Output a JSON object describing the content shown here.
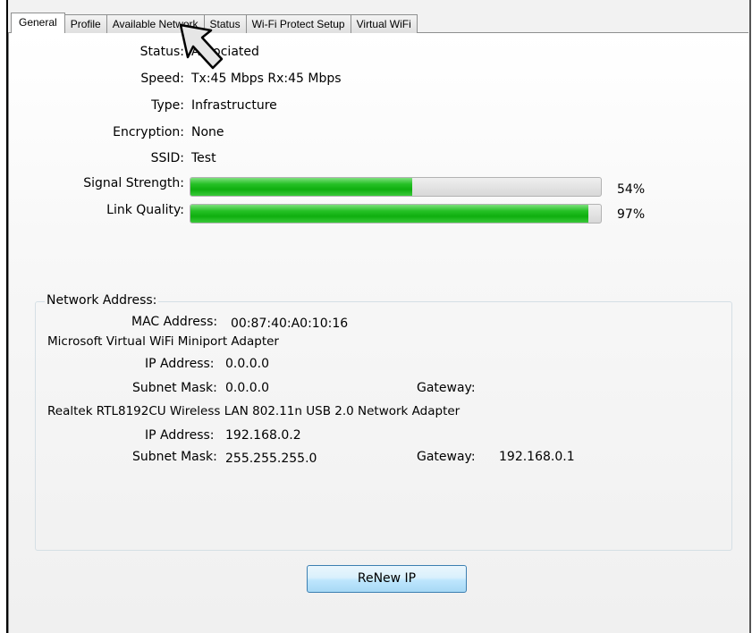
{
  "tabs": [
    {
      "label": "General",
      "active": true
    },
    {
      "label": "Profile",
      "active": false
    },
    {
      "label": "Available Network",
      "active": false
    },
    {
      "label": "Status",
      "active": false
    },
    {
      "label": "Wi-Fi Protect Setup",
      "active": false
    },
    {
      "label": "Virtual WiFi",
      "active": false
    }
  ],
  "general": {
    "status_label": "Status:",
    "status_value": "Associated",
    "speed_label": "Speed:",
    "speed_value": "Tx:45 Mbps Rx:45 Mbps",
    "type_label": "Type:",
    "type_value": "Infrastructure",
    "encryption_label": "Encryption:",
    "encryption_value": "None",
    "ssid_label": "SSID:",
    "ssid_value": "Test",
    "signal_label": "Signal Strength:",
    "signal_percent": 54,
    "signal_text": "54%",
    "link_label": "Link Quality:",
    "link_percent": 97,
    "link_text": "97%"
  },
  "network_address": {
    "title": "Network Address:",
    "mac_label": "MAC Address:",
    "mac_value": "00:87:40:A0:10:16",
    "adapters": [
      {
        "name": "Microsoft Virtual WiFi Miniport Adapter",
        "ip_label": "IP Address:",
        "ip_value": "0.0.0.0",
        "subnet_label": "Subnet Mask:",
        "subnet_value": "0.0.0.0",
        "gateway_label": "Gateway:",
        "gateway_value": ""
      },
      {
        "name": "Realtek RTL8192CU Wireless LAN 802.11n USB 2.0 Network Adapter",
        "ip_label": "IP Address:",
        "ip_value": "192.168.0.2",
        "subnet_label": "Subnet Mask:",
        "subnet_value": "255.255.255.0",
        "gateway_label": "Gateway:",
        "gateway_value": "192.168.0.1"
      }
    ]
  },
  "renew_button": "ReNew IP",
  "colors": {
    "bar_fill": "#1fb81f",
    "bar_track": "#dcdcdc",
    "button_border": "#3c7fb1",
    "tab_border": "#8e8f8f"
  },
  "icons": {
    "cursor": "arrow-cursor-icon"
  }
}
